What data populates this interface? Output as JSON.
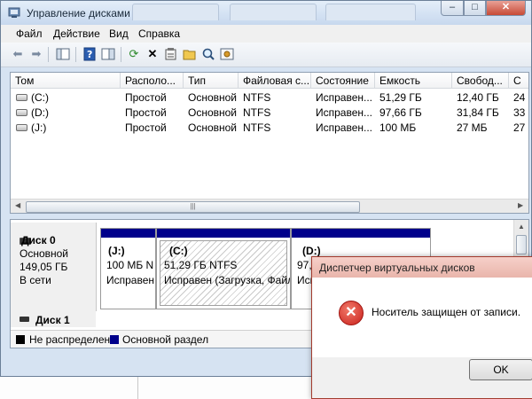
{
  "window": {
    "title": "Управление дисками",
    "controls": {
      "minimize": "–",
      "maximize": "□",
      "close": "✕"
    }
  },
  "menu": [
    "Файл",
    "Действие",
    "Вид",
    "Справка"
  ],
  "toolbar": [
    "back-icon",
    "forward-icon",
    "console-tree-icon",
    "help-icon",
    "view-icon",
    "refresh-icon",
    "delete-icon",
    "properties-icon",
    "open-icon",
    "search-icon",
    "settings-icon"
  ],
  "volumes": {
    "columns": [
      "Том",
      "Располо...",
      "Тип",
      "Файловая с...",
      "Состояние",
      "Емкость",
      "Свобод...",
      "С"
    ],
    "rows": [
      {
        "name": "(C:)",
        "layout": "Простой",
        "type": "Основной",
        "fs": "NTFS",
        "status": "Исправен...",
        "capacity": "51,29 ГБ",
        "free": "12,40 ГБ",
        "pct": "24"
      },
      {
        "name": "(D:)",
        "layout": "Простой",
        "type": "Основной",
        "fs": "NTFS",
        "status": "Исправен...",
        "capacity": "97,66 ГБ",
        "free": "31,84 ГБ",
        "pct": "33"
      },
      {
        "name": "(J:)",
        "layout": "Простой",
        "type": "Основной",
        "fs": "NTFS",
        "status": "Исправен...",
        "capacity": "100 МБ",
        "free": "27 МБ",
        "pct": "27"
      }
    ],
    "scroll_thumb": "|||"
  },
  "disks": {
    "disk0": {
      "name": "Диск 0",
      "type": "Основной",
      "size": "149,05 ГБ",
      "status": "В сети",
      "partitions": [
        {
          "name": "(J:)",
          "size": "100 МБ N",
          "status": "Исправен"
        },
        {
          "name": "(C:)",
          "size": "51,29 ГБ NTFS",
          "status": "Исправен (Загрузка, Файл"
        },
        {
          "name": "(D:)",
          "size": "97,6",
          "status": "Испр"
        }
      ]
    },
    "disk1": {
      "name": "Диск 1"
    }
  },
  "legend": [
    {
      "label": "Не распределен",
      "color": "#000000"
    },
    {
      "label": "Основной раздел",
      "color": "#00008b"
    }
  ],
  "dialog": {
    "title": "Диспетчер виртуальных дисков",
    "message": "Носитель защищен от записи.",
    "ok": "OK",
    "icon": "error-icon"
  }
}
